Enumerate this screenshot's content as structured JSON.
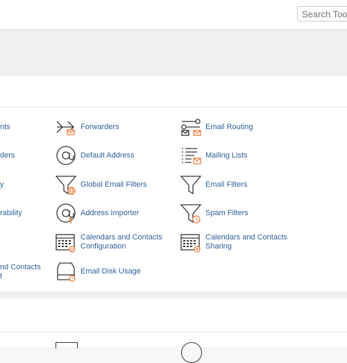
{
  "header": {
    "search_placeholder": "Search Tools"
  },
  "email_section": {
    "left_fragments": [
      "nts",
      "ders",
      "y",
      "rability",
      "nd Contacts",
      "t"
    ],
    "tools": [
      {
        "label": "Forwarders",
        "icon": "forwarders-icon"
      },
      {
        "label": "Email Routing",
        "icon": "email-routing-icon"
      },
      {
        "label": "Default Address",
        "icon": "default-address-icon"
      },
      {
        "label": "Mailing Lists",
        "icon": "mailing-lists-icon"
      },
      {
        "label": "Global Email Filters",
        "icon": "global-email-filters-icon"
      },
      {
        "label": "Email Filters",
        "icon": "email-filters-icon"
      },
      {
        "label": "Address Importer",
        "icon": "address-importer-icon"
      },
      {
        "label": "Spam Filters",
        "icon": "spam-filters-icon"
      },
      {
        "label": "Calendars and Contacts Configuration",
        "icon": "calendar-config-icon"
      },
      {
        "label": "Calendars and Contacts Sharing",
        "icon": "calendar-sharing-icon"
      },
      {
        "label": "Email Disk Usage",
        "icon": "email-disk-usage-icon"
      }
    ]
  },
  "colors": {
    "link": "#2f5f9b",
    "accent": "#f07c3a",
    "icon_stroke": "#333333"
  }
}
